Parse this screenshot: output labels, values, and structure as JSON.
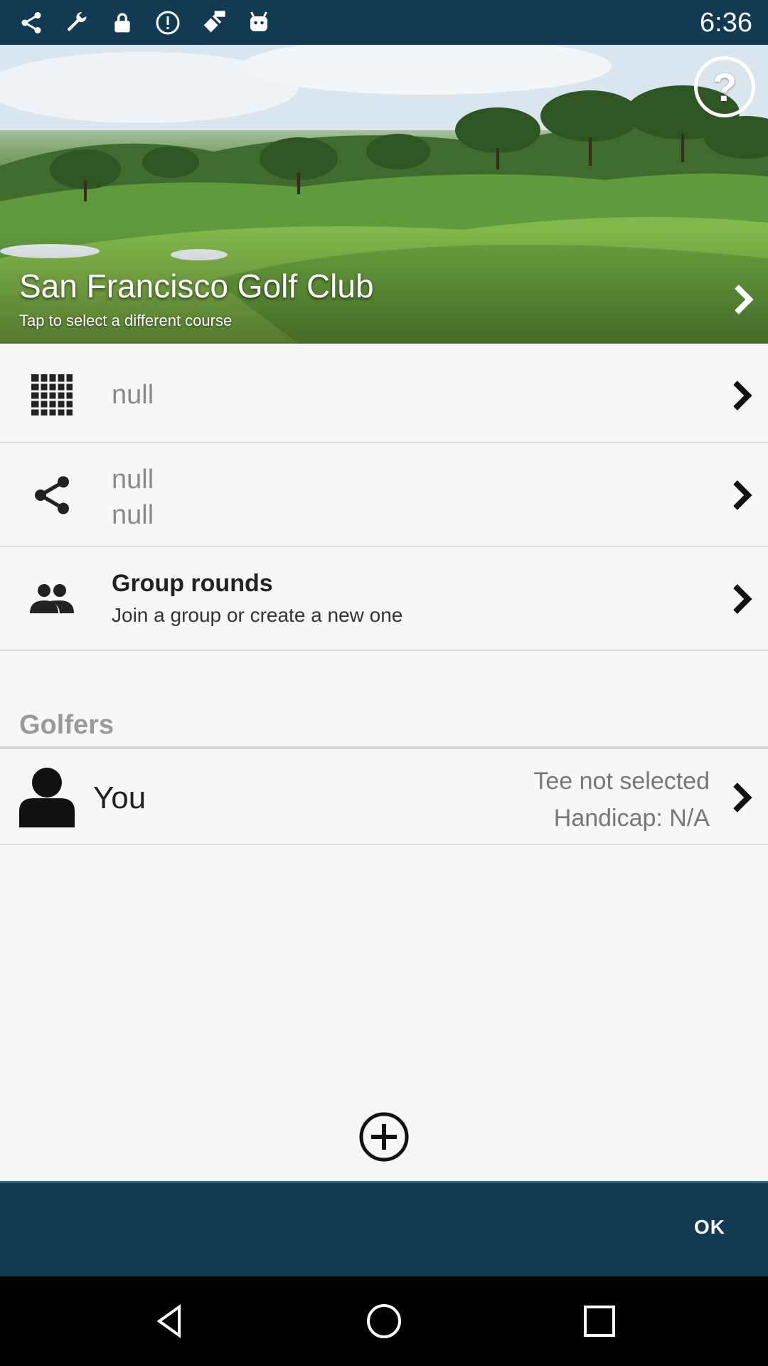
{
  "status_bar": {
    "time": "6:36",
    "icons": [
      "share-icon",
      "wrench-icon",
      "lock-icon",
      "alert-icon",
      "fake-gps-icon",
      "android-icon"
    ]
  },
  "course": {
    "name": "San Francisco Golf Club",
    "subtitle": "Tap to select a different course"
  },
  "rows": [
    {
      "icon": "scorecard-grid-icon",
      "line1": "null"
    },
    {
      "icon": "share-icon",
      "line1": "null",
      "line2": "null"
    },
    {
      "icon": "group-icon",
      "title": "Group rounds",
      "subtitle": "Join a group or create a new one"
    }
  ],
  "golfers": {
    "header": "Golfers",
    "items": [
      {
        "name": "You",
        "tee": "Tee not selected",
        "handicap": "Handicap: N/A"
      }
    ]
  },
  "footer": {
    "ok_label": "OK"
  },
  "colors": {
    "statusbar": "#123a52",
    "bottombar": "#123a52",
    "accent_line": "#1f6a8f"
  }
}
